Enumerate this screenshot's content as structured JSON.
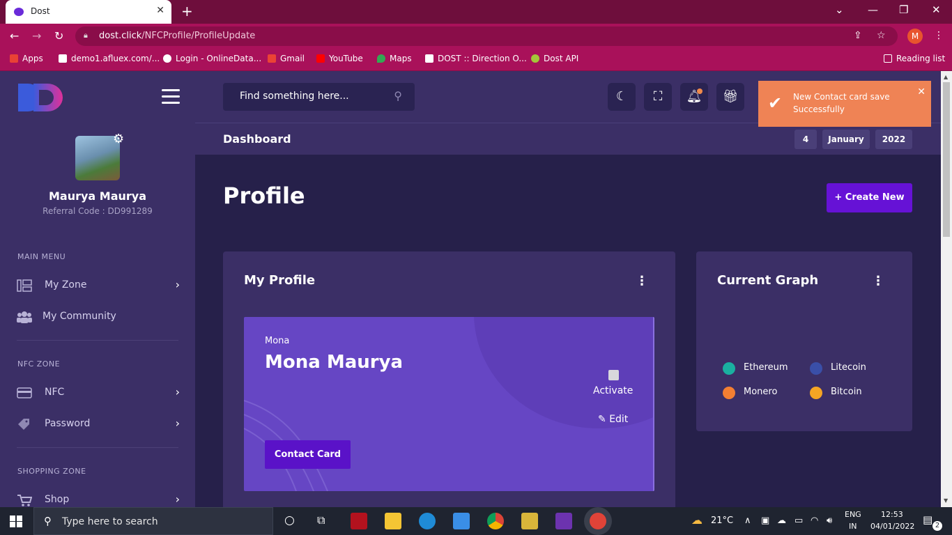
{
  "browser": {
    "tab_title": "Dost",
    "url_host": "dost.click",
    "url_path": "/NFCProfile/ProfileUpdate",
    "profile_initial": "M",
    "bookmarks": [
      {
        "label": "Apps",
        "color": "#e94235"
      },
      {
        "label": "demo1.afluex.com/...",
        "color": "#ffffff"
      },
      {
        "label": "Login - OnlineData...",
        "color": "#ffffff"
      },
      {
        "label": "Gmail",
        "color": "#ea4335"
      },
      {
        "label": "YouTube",
        "color": "#ff0000"
      },
      {
        "label": "Maps",
        "color": "#34a853"
      },
      {
        "label": "DOST :: Direction O...",
        "color": "#ffffff"
      },
      {
        "label": "Dost API",
        "color": "#a4c639"
      }
    ],
    "reading_list": "Reading list"
  },
  "sidebar": {
    "user_name": "Maurya Maurya",
    "referral": "Referral Code : DD991289",
    "sections": {
      "main": "MAIN MENU",
      "nfc": "NFC ZONE",
      "shop": "SHOPPING ZONE"
    },
    "items": {
      "my_zone": "My Zone",
      "my_community": "My Community",
      "nfc": "NFC",
      "password": "Password",
      "shop": "Shop"
    }
  },
  "topbar": {
    "search_placeholder": "Find something here..."
  },
  "breadcrumb": {
    "title": "Dashboard",
    "day": "4",
    "month": "January",
    "year": "2022"
  },
  "toast": {
    "message": "New Contact card save Successfully"
  },
  "page": {
    "title": "Profile",
    "create_button": "+ Create New"
  },
  "profile_card": {
    "title": "My Profile",
    "first_name": "Mona",
    "full_name": "Mona Maurya",
    "activate": "Activate",
    "edit": "Edit",
    "contact_card": "Contact Card"
  },
  "graph": {
    "title": "Current Graph",
    "legend": [
      {
        "label": "Ethereum",
        "color": "#1ab0a0"
      },
      {
        "label": "Litecoin",
        "color": "#3a4fa8"
      },
      {
        "label": "Monero",
        "color": "#f37f32"
      },
      {
        "label": "Bitcoin",
        "color": "#f5a524"
      }
    ]
  },
  "taskbar": {
    "search_text": "Type here to search",
    "weather": "21°C",
    "lang_top": "ENG",
    "lang_bottom": "IN",
    "time": "12:53",
    "date": "04/01/2022",
    "notif_count": "2"
  }
}
